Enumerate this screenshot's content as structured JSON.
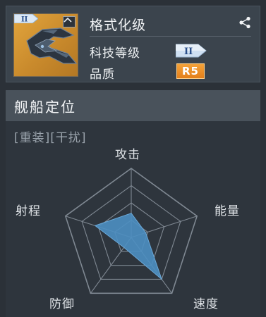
{
  "ship": {
    "name": "格式化级",
    "tier_roman": "II",
    "tech_level_label": "科技等级",
    "tech_level_value": "II",
    "quality_label": "品质",
    "quality_value": "R5"
  },
  "section": {
    "title": "舰船定位",
    "tags": "[重装][干扰]"
  },
  "radar": {
    "axes": [
      "攻击",
      "能量",
      "速度",
      "防御",
      "射程"
    ],
    "values": [
      0.35,
      0.22,
      0.75,
      0.18,
      0.55
    ],
    "fill_color": "#4d8fc2",
    "grid_color": "#7f8892"
  },
  "colors": {
    "quality_badge": "#e9861f",
    "tech_badge": "#cfe0f2",
    "background": "#2b3138"
  },
  "icons": {
    "share": "share-icon",
    "collapse": "chevron-up-icon"
  }
}
